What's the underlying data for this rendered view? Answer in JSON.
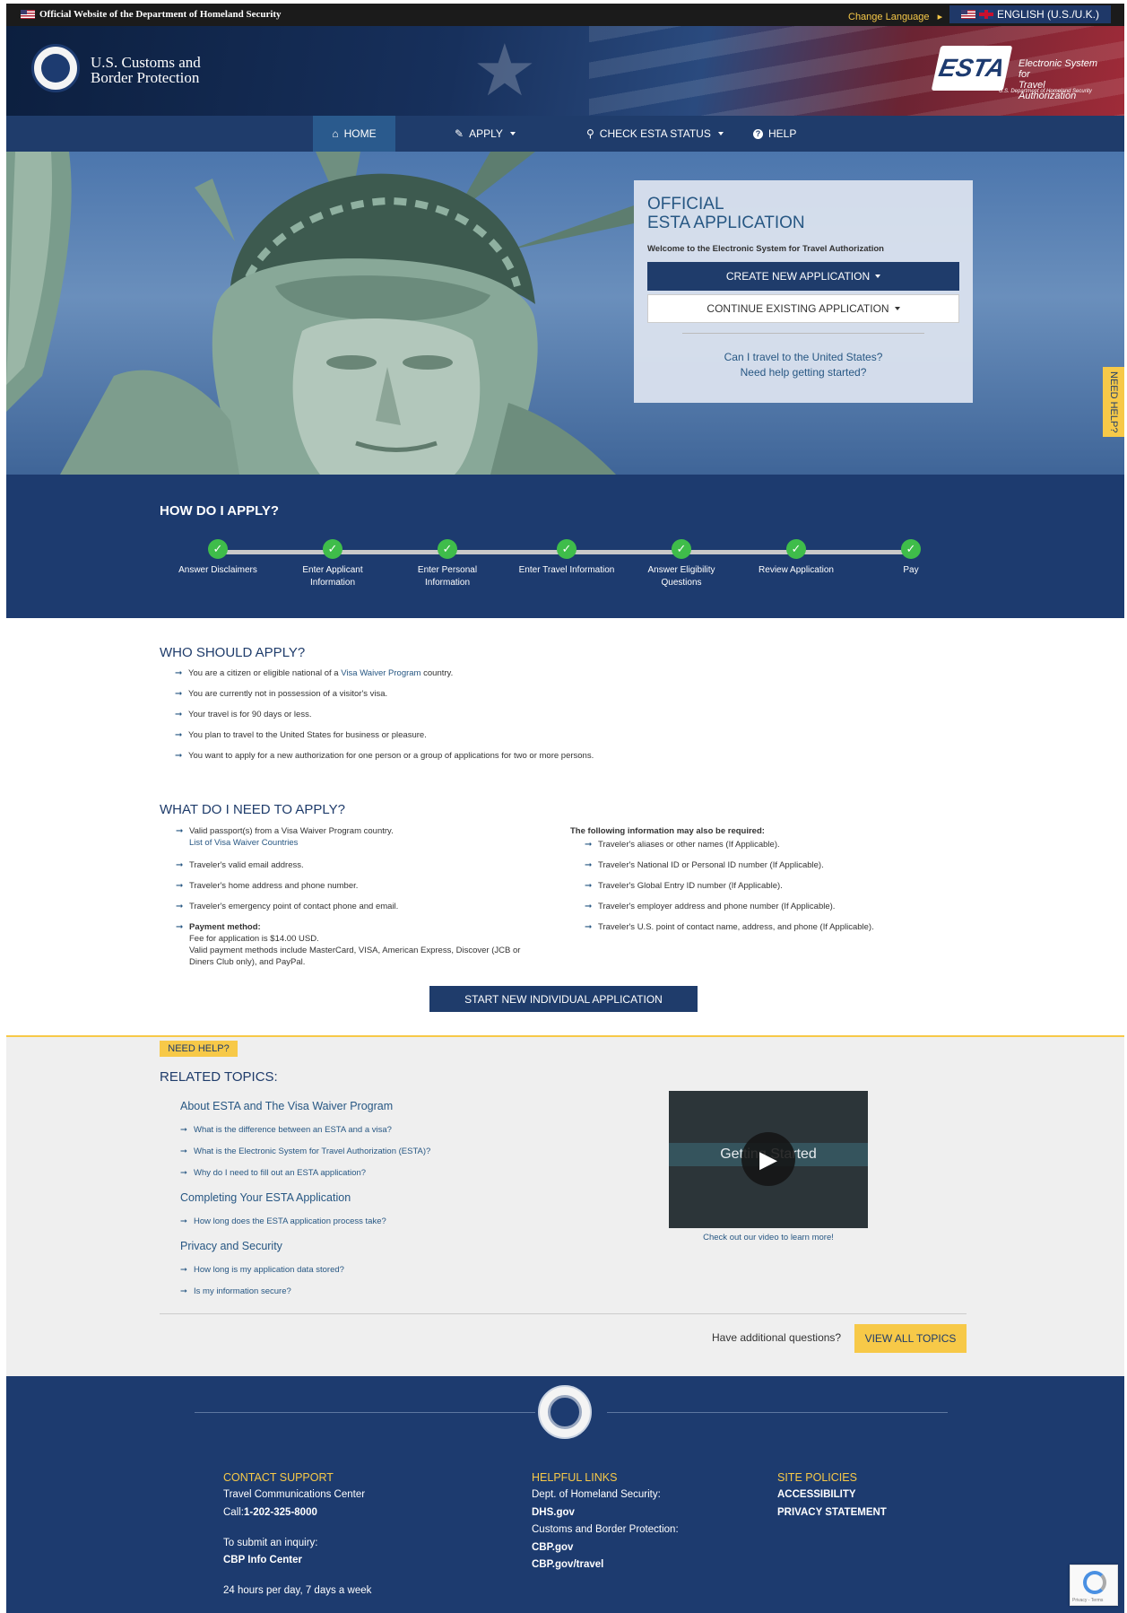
{
  "gov_banner": {
    "text": "Official Website of the Department of Homeland Security",
    "change_language": "Change Language",
    "language": "ENGLISH (U.S./U.K.)"
  },
  "header": {
    "agency_line1": "U.S. Customs and",
    "agency_line2": "Border Protection",
    "esta_word": "ESTA",
    "esta_sub1": "Electronic System for",
    "esta_sub2": "Travel Authorization",
    "esta_tiny": "U.S. Department of Homeland Security"
  },
  "nav": {
    "home": "HOME",
    "apply": "APPLY",
    "check_status": "CHECK ESTA STATUS",
    "help": "HELP"
  },
  "hero": {
    "title_line1": "OFFICIAL",
    "title_line2": "ESTA APPLICATION",
    "welcome": "Welcome to the Electronic System for Travel Authorization",
    "create_button": "CREATE NEW APPLICATION",
    "continue_button": "CONTINUE EXISTING APPLICATION",
    "link_travel": "Can I travel to the United States?",
    "link_help": "Need help getting started?",
    "need_help_tab": "NEED HELP?"
  },
  "how_to_apply": {
    "title": "HOW DO I APPLY?",
    "steps": [
      {
        "line1": "Answer Disclaimers",
        "line2": ""
      },
      {
        "line1": "Enter Applicant",
        "line2": "Information"
      },
      {
        "line1": "Enter Personal",
        "line2": "Information"
      },
      {
        "line1": "Enter Travel Information",
        "line2": ""
      },
      {
        "line1": "Answer Eligibility",
        "line2": "Questions"
      },
      {
        "line1": "Review Application",
        "line2": ""
      },
      {
        "line1": "Pay",
        "line2": ""
      }
    ]
  },
  "who_should_apply": {
    "title": "WHO SHOULD APPLY?",
    "item1_pre": "You are a citizen or eligible national of a ",
    "item1_link": "Visa Waiver Program",
    "item1_post": " country.",
    "item2": "You are currently not in possession of a visitor's visa.",
    "item3": "Your travel is for 90 days or less.",
    "item4": "You plan to travel to the United States for business or pleasure.",
    "item5": "You want to apply for a new authorization for one person or a group of applications for two or more persons."
  },
  "what_need": {
    "title": "WHAT DO I NEED TO APPLY?",
    "left1": "Valid passport(s) from a Visa Waiver Program country.",
    "left1_link": "List of Visa Waiver Countries",
    "left2": "Traveler's valid email address.",
    "left3": "Traveler's home address and phone number.",
    "left4": "Traveler's emergency point of contact phone and email.",
    "payment_label": "Payment method:",
    "payment_fee": "Fee for application is $14.00 USD.",
    "payment_methods1": "Valid payment methods include MasterCard, VISA, American Express, Discover (JCB or",
    "payment_methods2": "Diners Club only), and PayPal.",
    "right_head": "The following information may also be required:",
    "right1": "Traveler's aliases or other names (If Applicable).",
    "right2": "Traveler's National ID or Personal ID number (If Applicable).",
    "right3": "Traveler's Global Entry ID number (If Applicable).",
    "right4": "Traveler's employer address and phone number (If Applicable).",
    "right5": "Traveler's U.S. point of contact name, address, and phone (If Applicable).",
    "start_button": "START NEW INDIVIDUAL APPLICATION"
  },
  "related": {
    "badge": "NEED HELP?",
    "title": "RELATED TOPICS:",
    "cat1": "About ESTA and The Visa Waiver Program",
    "q1": "What is the difference between an ESTA and a visa?",
    "q2": "What is the Electronic System for Travel Authorization (ESTA)?",
    "q3": "Why do I need to fill out an ESTA application?",
    "cat2": "Completing Your ESTA Application",
    "q4": "How long does the ESTA application process take?",
    "cat3": "Privacy and Security",
    "q5": "How long is my application data stored?",
    "q6": "Is my information secure?",
    "video_title": "Getting Started",
    "video_caption": "Check out our video to learn more!",
    "additional": "Have additional questions?",
    "view_all": "VIEW ALL TOPICS"
  },
  "footer": {
    "contact_head": "CONTACT SUPPORT",
    "contact_center": "Travel Communications Center",
    "call_label": "Call:",
    "phone": "1-202-325-8000",
    "submit_inquiry": "To submit an inquiry:",
    "info_center": "CBP Info Center",
    "hours": "24 hours per day, 7 days a week",
    "helpful_head": "HELPFUL LINKS",
    "dhs_label": "Dept. of Homeland Security:",
    "dhs_link": "DHS.gov",
    "cbp_label": "Customs and Border Protection:",
    "cbp_link": "CBP.gov",
    "cbp_travel": "CBP.gov/travel",
    "policies_head": "SITE POLICIES",
    "accessibility": "ACCESSIBILITY",
    "privacy": "PRIVACY STATEMENT",
    "recaptcha_text": "Privacy - Terms"
  },
  "colors": {
    "navy": "#1d3b6f",
    "accent_yellow": "#f7c948",
    "link_blue": "#275783",
    "step_green": "#3fbd4a"
  },
  "icons": [
    "flag-us-icon",
    "flag-uk-icon",
    "home-icon",
    "pencil-icon",
    "search-icon",
    "question-circle-icon",
    "check-icon",
    "arrow-right-icon",
    "play-icon",
    "cbp-seal-icon",
    "dhs-seal-icon",
    "recaptcha-icon"
  ]
}
